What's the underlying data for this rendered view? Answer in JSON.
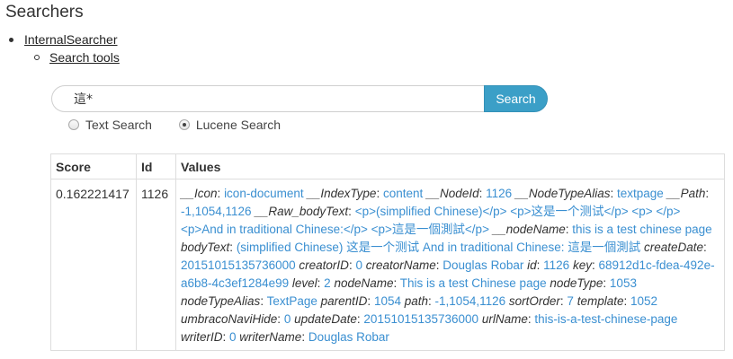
{
  "page": {
    "title": "Searchers"
  },
  "tree": {
    "searcher_link": "InternalSearcher",
    "tools_link": "Search tools"
  },
  "search": {
    "query": "這*",
    "button_label": "Search",
    "options": [
      {
        "label": "Text Search",
        "selected": false
      },
      {
        "label": "Lucene Search",
        "selected": true
      }
    ]
  },
  "results": {
    "headers": {
      "score": "Score",
      "id": "Id",
      "values": "Values"
    },
    "rows": [
      {
        "score": "0.162221417",
        "id": "1126",
        "fields": [
          {
            "key": "__Icon",
            "value": "icon-document"
          },
          {
            "key": "__IndexType",
            "value": "content"
          },
          {
            "key": "__NodeId",
            "value": "1126"
          },
          {
            "key": "__NodeTypeAlias",
            "value": "textpage"
          },
          {
            "key": "__Path",
            "value": "-1,1054,1126"
          },
          {
            "key": "__Raw_bodyText",
            "value": "<p>(simplified Chinese)</p> <p>这是一个测试</p> <p> </p> <p>And in traditional Chinese:</p> <p>這是一個測試</p>"
          },
          {
            "key": "__nodeName",
            "value": "this is a test chinese page"
          },
          {
            "key": "bodyText",
            "value": "(simplified Chinese) 这是一个测试   And in traditional Chinese: 這是一個測試"
          },
          {
            "key": "createDate",
            "value": "20151015135736000"
          },
          {
            "key": "creatorID",
            "value": "0"
          },
          {
            "key": "creatorName",
            "value": "Douglas Robar"
          },
          {
            "key": "id",
            "value": "1126"
          },
          {
            "key": "key",
            "value": "68912d1c-fdea-492e-a6b8-4c3ef1284e99"
          },
          {
            "key": "level",
            "value": "2"
          },
          {
            "key": "nodeName",
            "value": "This is a test Chinese page"
          },
          {
            "key": "nodeType",
            "value": "1053"
          },
          {
            "key": "nodeTypeAlias",
            "value": "TextPage"
          },
          {
            "key": "parentID",
            "value": "1054"
          },
          {
            "key": "path",
            "value": "-1,1054,1126"
          },
          {
            "key": "sortOrder",
            "value": "7"
          },
          {
            "key": "template",
            "value": "1052"
          },
          {
            "key": "umbracoNaviHide",
            "value": "0"
          },
          {
            "key": "updateDate",
            "value": "20151015135736000"
          },
          {
            "key": "urlName",
            "value": "this-is-a-test-chinese-page"
          },
          {
            "key": "writerID",
            "value": "0"
          },
          {
            "key": "writerName",
            "value": "Douglas Robar"
          }
        ]
      }
    ]
  }
}
